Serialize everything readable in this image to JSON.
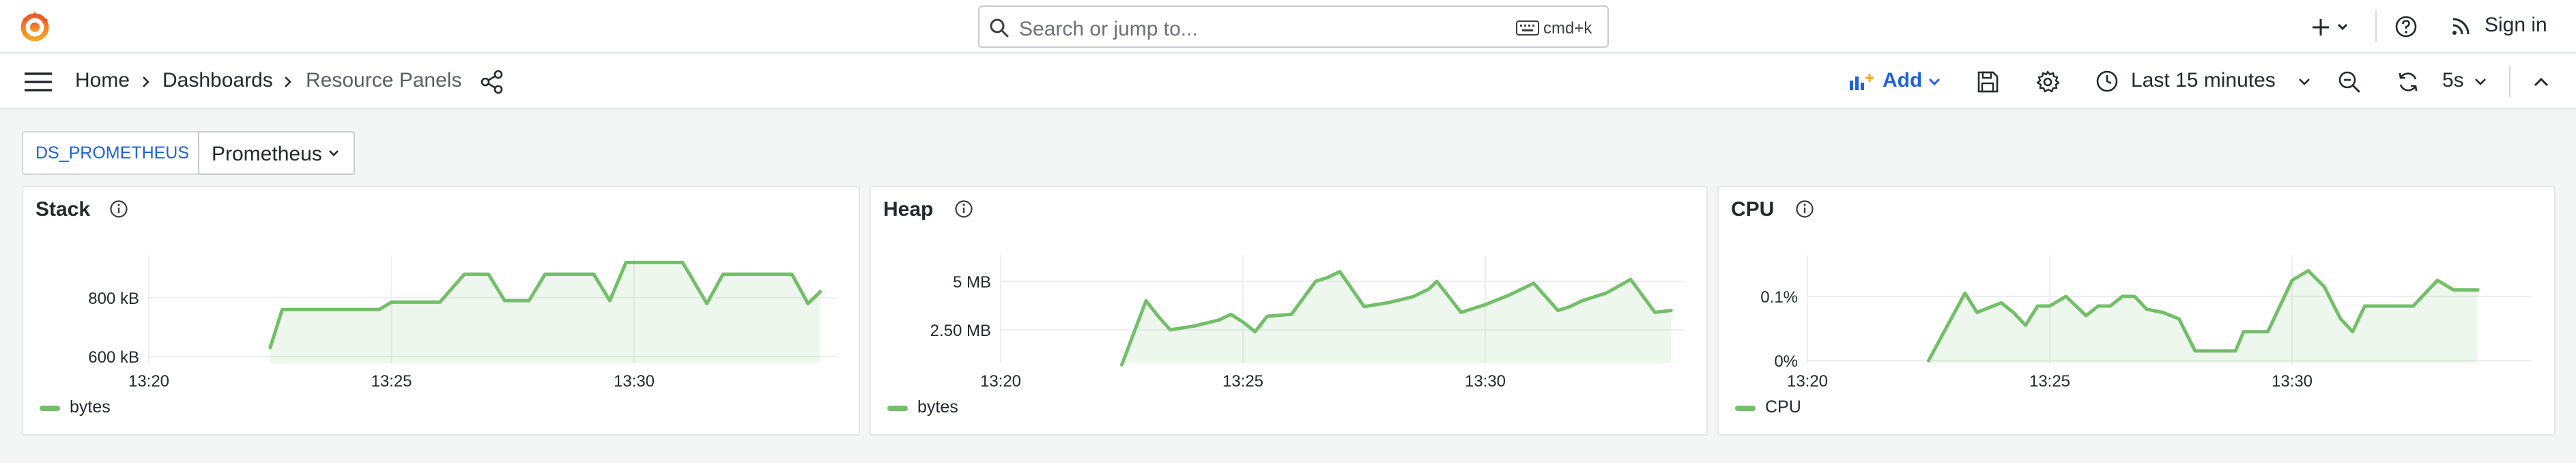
{
  "topbar": {
    "search_placeholder": "Search or jump to...",
    "search_shortcut": "cmd+k",
    "signin_label": "Sign in"
  },
  "breadcrumbs": [
    "Home",
    "Dashboards",
    "Resource Panels"
  ],
  "toolbar": {
    "add_label": "Add",
    "time_range": "Last 15 minutes",
    "refresh_interval": "5s",
    "accent_color": "#1f62e0"
  },
  "variables": {
    "label": "DS_PROMETHEUS",
    "value": "Prometheus"
  },
  "panels": [
    {
      "title": "Stack",
      "legend": "bytes"
    },
    {
      "title": "Heap",
      "legend": "bytes"
    },
    {
      "title": "CPU",
      "legend": "CPU"
    }
  ],
  "chart_data": [
    {
      "type": "area",
      "title": "Stack",
      "x_ticks": [
        "13:20",
        "13:25",
        "13:30"
      ],
      "y_ticks": [
        "600 kB",
        "800 kB"
      ],
      "series": [
        {
          "name": "bytes",
          "color": "#73bf69",
          "x": [
            "13:22:30",
            "13:22:45",
            "13:23",
            "13:24",
            "13:24:45",
            "13:25",
            "13:25:30",
            "13:26",
            "13:26:30",
            "13:27",
            "13:27:20",
            "13:27:50",
            "13:28:10",
            "13:28:40",
            "13:29:10",
            "13:29:30",
            "13:29:50",
            "13:30:10",
            "13:31",
            "13:31:30",
            "13:31:50",
            "13:32:10",
            "13:33:15",
            "13:33:35",
            "13:33:50"
          ],
          "values": [
            630,
            760,
            760,
            760,
            760,
            785,
            785,
            785,
            880,
            880,
            790,
            790,
            880,
            880,
            880,
            790,
            920,
            920,
            920,
            780,
            880,
            880,
            880,
            780,
            820
          ]
        }
      ]
    },
    {
      "type": "area",
      "title": "Heap",
      "x_ticks": [
        "13:20",
        "13:25",
        "13:30"
      ],
      "y_ticks": [
        "2.50 MB",
        "5 MB"
      ],
      "series": [
        {
          "name": "bytes",
          "color": "#73bf69",
          "x": [
            "13:22:30",
            "13:23",
            "13:23:15",
            "13:23:30",
            "13:24",
            "13:24:30",
            "13:24:45",
            "13:25",
            "13:25:15",
            "13:25:30",
            "13:26",
            "13:26:30",
            "13:26:45",
            "13:27",
            "13:27:30",
            "13:28",
            "13:28:30",
            "13:28:50",
            "13:29",
            "13:29:30",
            "13:30",
            "13:30:30",
            "13:31",
            "13:31:30",
            "13:31:45",
            "13:32",
            "13:32:30",
            "13:33",
            "13:33:30",
            "13:33:50"
          ],
          "values": [
            0.7,
            4.0,
            3.2,
            2.5,
            2.7,
            3.0,
            3.3,
            2.9,
            2.4,
            3.2,
            3.3,
            5.0,
            5.2,
            5.5,
            3.7,
            3.9,
            4.2,
            4.6,
            5.0,
            3.4,
            3.8,
            4.3,
            4.9,
            3.5,
            3.7,
            4.0,
            4.4,
            5.1,
            3.4,
            3.5
          ]
        }
      ]
    },
    {
      "type": "area",
      "title": "CPU",
      "x_ticks": [
        "13:20",
        "13:25",
        "13:30"
      ],
      "y_ticks": [
        "0%",
        "0.1%"
      ],
      "series": [
        {
          "name": "CPU",
          "color": "#73bf69",
          "x": [
            "13:22:30",
            "13:23",
            "13:23:15",
            "13:23:30",
            "13:24",
            "13:24:15",
            "13:24:30",
            "13:24:45",
            "13:25",
            "13:25:20",
            "13:25:45",
            "13:26",
            "13:26:15",
            "13:26:30",
            "13:26:45",
            "13:27",
            "13:27:20",
            "13:27:40",
            "13:28",
            "13:28:30",
            "13:28:50",
            "13:29",
            "13:29:30",
            "13:30",
            "13:30:20",
            "13:30:40",
            "13:31",
            "13:31:15",
            "13:31:30",
            "13:31:45",
            "13:32",
            "13:32:30",
            "13:33",
            "13:33:20",
            "13:33:40",
            "13:33:50"
          ],
          "values": [
            0.0,
            0.07,
            0.105,
            0.075,
            0.09,
            0.075,
            0.055,
            0.085,
            0.085,
            0.1,
            0.07,
            0.085,
            0.085,
            0.1,
            0.1,
            0.08,
            0.075,
            0.065,
            0.015,
            0.015,
            0.015,
            0.045,
            0.045,
            0.125,
            0.14,
            0.115,
            0.065,
            0.045,
            0.085,
            0.085,
            0.085,
            0.085,
            0.125,
            0.11,
            0.11,
            0.11
          ]
        }
      ]
    }
  ]
}
